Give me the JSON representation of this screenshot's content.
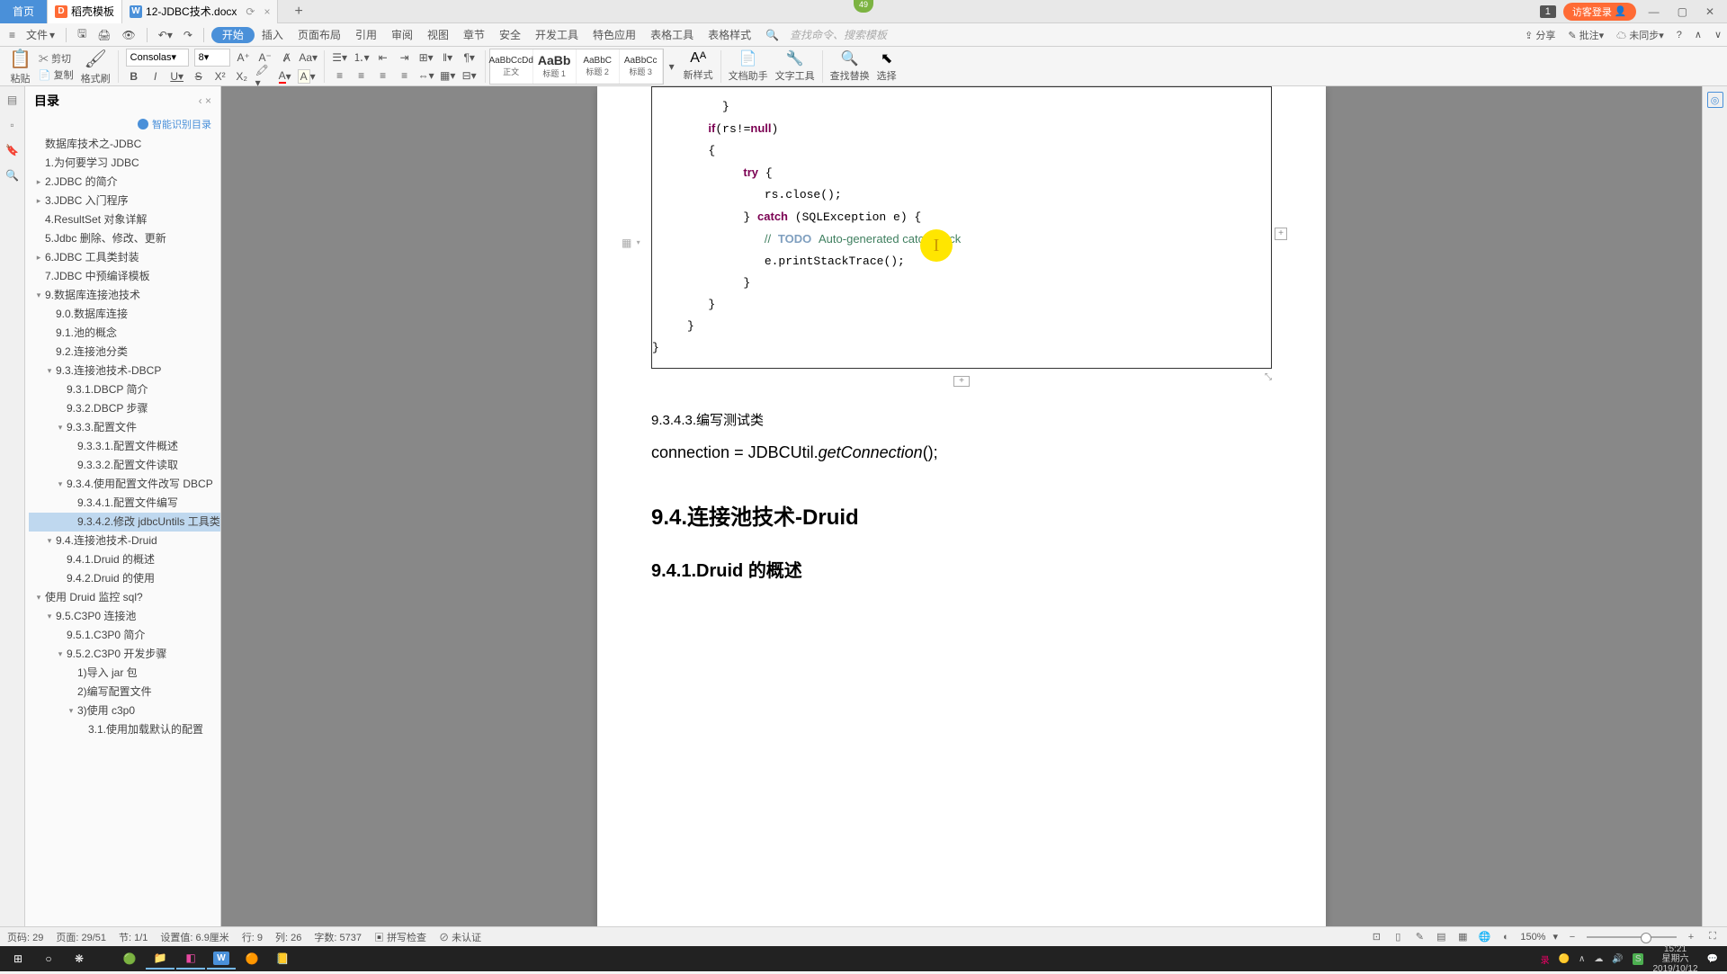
{
  "titlebar": {
    "home": "首页",
    "template": "稻壳模板",
    "doc": "12-JDBC技术.docx",
    "notif": "1",
    "login": "访客登录",
    "topnum": "49"
  },
  "toolbar1": {
    "file": "文件",
    "menus": [
      "开始",
      "插入",
      "页面布局",
      "引用",
      "审阅",
      "视图",
      "章节",
      "安全",
      "开发工具",
      "特色应用",
      "表格工具",
      "表格样式"
    ],
    "search_ph": "查找命令、搜索模板",
    "share": "分享",
    "comment": "批注",
    "sync": "未同步",
    "help": "?"
  },
  "toolbar2": {
    "paste": "粘贴",
    "cut": "剪切",
    "copy": "复制",
    "brush": "格式刷",
    "font": "Consolas",
    "size": "8",
    "styles": [
      {
        "preview": "AaBbCcDd",
        "name": "正文"
      },
      {
        "preview": "AaBb",
        "name": "标题 1",
        "big": true
      },
      {
        "preview": "AaBbC",
        "name": "标题 2"
      },
      {
        "preview": "AaBbCc",
        "name": "标题 3"
      }
    ],
    "newstyle": "新样式",
    "docassist": "文档助手",
    "texttool": "文字工具",
    "findreplace": "查找替换",
    "select": "选择"
  },
  "sidebar": {
    "title": "目录",
    "auto": "智能识别目录",
    "items": [
      {
        "t": "数据库技术之-JDBC",
        "l": 1
      },
      {
        "t": "1.为何要学习 JDBC",
        "l": 1
      },
      {
        "t": "2.JDBC 的简介",
        "l": 1,
        "c": "▸"
      },
      {
        "t": "3.JDBC 入门程序",
        "l": 1,
        "c": "▸"
      },
      {
        "t": "4.ResultSet 对象详解",
        "l": 1
      },
      {
        "t": "5.Jdbc 删除、修改、更新",
        "l": 1
      },
      {
        "t": "6.JDBC 工具类封装",
        "l": 1,
        "c": "▸"
      },
      {
        "t": "7.JDBC 中预编译模板",
        "l": 1
      },
      {
        "t": "9.数据库连接池技术",
        "l": 1,
        "c": "▾"
      },
      {
        "t": "9.0.数据库连接",
        "l": 2
      },
      {
        "t": "9.1.池的概念",
        "l": 2
      },
      {
        "t": "9.2.连接池分类",
        "l": 2
      },
      {
        "t": "9.3.连接池技术-DBCP",
        "l": 2,
        "c": "▾"
      },
      {
        "t": "9.3.1.DBCP 简介",
        "l": 3
      },
      {
        "t": "9.3.2.DBCP 步骤",
        "l": 3
      },
      {
        "t": "9.3.3.配置文件",
        "l": 3,
        "c": "▾"
      },
      {
        "t": "9.3.3.1.配置文件概述",
        "l": 4
      },
      {
        "t": "9.3.3.2.配置文件读取",
        "l": 4
      },
      {
        "t": "9.3.4.使用配置文件改写 DBCP",
        "l": 3,
        "c": "▾"
      },
      {
        "t": "9.3.4.1.配置文件编写",
        "l": 4
      },
      {
        "t": "9.3.4.2.修改 jdbcUntils 工具类",
        "l": 4,
        "active": true
      },
      {
        "t": "9.4.连接池技术-Druid",
        "l": 2,
        "c": "▾"
      },
      {
        "t": "9.4.1.Druid 的概述",
        "l": 3
      },
      {
        "t": "9.4.2.Druid 的使用",
        "l": 3
      },
      {
        "t": "使用 Druid 监控 sql?",
        "l": 1,
        "c": "▾"
      },
      {
        "t": "9.5.C3P0 连接池",
        "l": 2,
        "c": "▾"
      },
      {
        "t": "9.5.1.C3P0 简介",
        "l": 3
      },
      {
        "t": "9.5.2.C3P0 开发步骤",
        "l": 3,
        "c": "▾"
      },
      {
        "t": "1)导入 jar 包",
        "l": 4
      },
      {
        "t": "2)编写配置文件",
        "l": 4
      },
      {
        "t": "3)使用 c3p0",
        "l": 4,
        "c": "▾"
      },
      {
        "t": "3.1.使用加载默认的配置",
        "l": 5
      }
    ]
  },
  "content": {
    "sec_title": "9.3.4.3.编写测试类",
    "codeline": "connection = JDBCUtil.",
    "codeline_i": "getConnection",
    "codeline_end": "();",
    "h2": "9.4.连接池技术-Druid",
    "h3": "9.4.1.Druid 的概述"
  },
  "statusbar": {
    "pgno": "页码: 29",
    "pg": "页面: 29/51",
    "sec": "节: 1/1",
    "set": "设置值: 6.9厘米",
    "row": "行: 9",
    "col": "列: 26",
    "chars": "字数: 5737",
    "spell": "拼写检查",
    "auth": "未认证",
    "zoom": "150%"
  },
  "clock": {
    "t": "15:21",
    "d": "星期六",
    "dt": "2019/10/12"
  }
}
